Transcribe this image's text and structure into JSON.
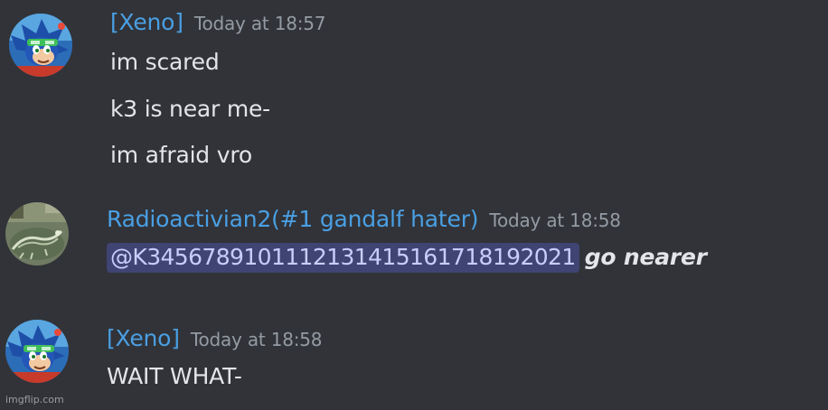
{
  "messages": [
    {
      "author": "[Xeno]",
      "timestamp": "Today at 18:57",
      "avatar_icon": "sonic-avatar-icon",
      "lines": [
        "im scared",
        "k3 is near me-",
        "im afraid vro"
      ]
    },
    {
      "author": "Radioactivian2(#1 gandalf hater)",
      "timestamp": "Today at 18:58",
      "avatar_icon": "lizard-avatar-icon",
      "mention": "@K3456789101112131415161718192021",
      "text_after_mention": "go nearer"
    },
    {
      "author": "[Xeno]",
      "timestamp": "Today at 18:58",
      "avatar_icon": "sonic-avatar-icon",
      "lines": [
        "WAIT WHAT-"
      ]
    }
  ],
  "watermark": "imgflip.com",
  "colors": {
    "background": "#313338",
    "username": "#4a9fe3",
    "timestamp": "#949ba4",
    "message_text": "#e3e5e8",
    "mention_bg": "#3f4473",
    "mention_text": "#c9cdfb"
  }
}
